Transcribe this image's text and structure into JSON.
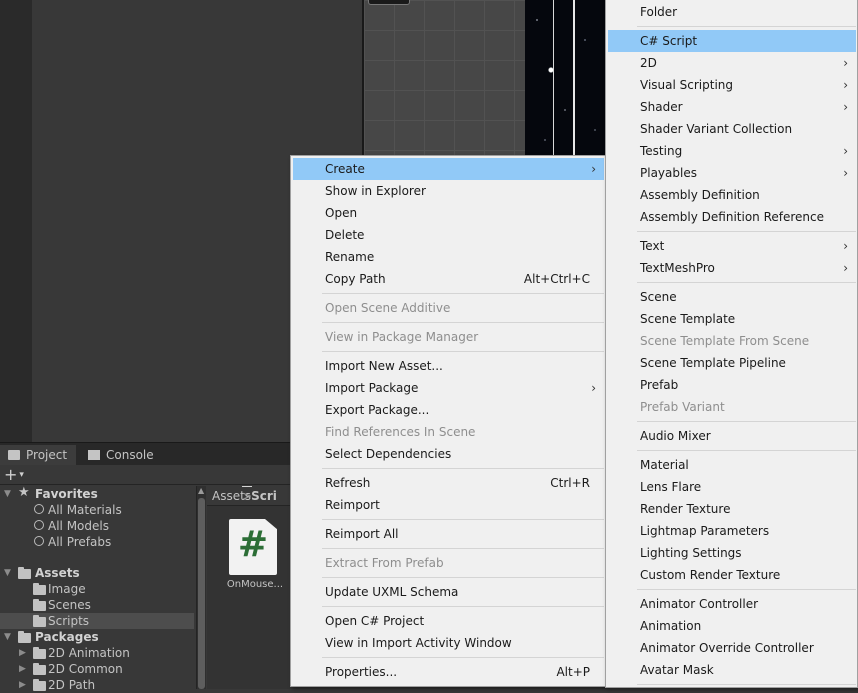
{
  "project_tabs": {
    "project": "Project",
    "console": "Console"
  },
  "toolbar": {
    "add": "+",
    "add_caret": "▾"
  },
  "tree": {
    "favorites": "Favorites",
    "all_materials": "All Materials",
    "all_models": "All Models",
    "all_prefabs": "All Prefabs",
    "assets": "Assets",
    "image": "Image",
    "scenes": "Scenes",
    "scripts": "Scripts",
    "packages": "Packages",
    "pkg_2d_animation": "2D Animation",
    "pkg_2d_common": "2D Common",
    "pkg_2d_path": "2D Path"
  },
  "breadcrumb": {
    "root": "Assets",
    "separator": ">",
    "current": "Scri"
  },
  "asset": {
    "glyph": "#",
    "name": "OnMouse..."
  },
  "context_menu": {
    "create": "Create",
    "show_in_explorer": "Show in Explorer",
    "open": "Open",
    "delete": "Delete",
    "rename": "Rename",
    "copy_path": "Copy Path",
    "copy_path_shortcut": "Alt+Ctrl+C",
    "open_scene_additive": "Open Scene Additive",
    "view_in_package_manager": "View in Package Manager",
    "import_new_asset": "Import New Asset...",
    "import_package": "Import Package",
    "export_package": "Export Package...",
    "find_references": "Find References In Scene",
    "select_dependencies": "Select Dependencies",
    "refresh": "Refresh",
    "refresh_shortcut": "Ctrl+R",
    "reimport": "Reimport",
    "reimport_all": "Reimport All",
    "extract_from_prefab": "Extract From Prefab",
    "update_uxml_schema": "Update UXML Schema",
    "open_csharp_project": "Open C# Project",
    "view_import_activity": "View in Import Activity Window",
    "properties": "Properties...",
    "properties_shortcut": "Alt+P",
    "submenu_arrow": "›"
  },
  "create_submenu": {
    "folder": "Folder",
    "csharp_script": "C# Script",
    "two_d": "2D",
    "visual_scripting": "Visual Scripting",
    "shader": "Shader",
    "shader_variant_collection": "Shader Variant Collection",
    "testing": "Testing",
    "playables": "Playables",
    "assembly_definition": "Assembly Definition",
    "assembly_definition_reference": "Assembly Definition Reference",
    "text": "Text",
    "textmeshpro": "TextMeshPro",
    "scene": "Scene",
    "scene_template": "Scene Template",
    "scene_template_from_scene": "Scene Template From Scene",
    "scene_template_pipeline": "Scene Template Pipeline",
    "prefab": "Prefab",
    "prefab_variant": "Prefab Variant",
    "audio_mixer": "Audio Mixer",
    "material": "Material",
    "lens_flare": "Lens Flare",
    "render_texture": "Render Texture",
    "lightmap_parameters": "Lightmap Parameters",
    "lighting_settings": "Lighting Settings",
    "custom_render_texture": "Custom Render Texture",
    "animator_controller": "Animator Controller",
    "animation": "Animation",
    "animator_override_controller": "Animator Override Controller",
    "avatar_mask": "Avatar Mask",
    "submenu_arrow": "›"
  },
  "colors": {
    "highlight": "#91c9f7",
    "menu_bg": "#f0f0f0",
    "editor_bg": "#383838",
    "script_icon": "#2c6e36"
  }
}
